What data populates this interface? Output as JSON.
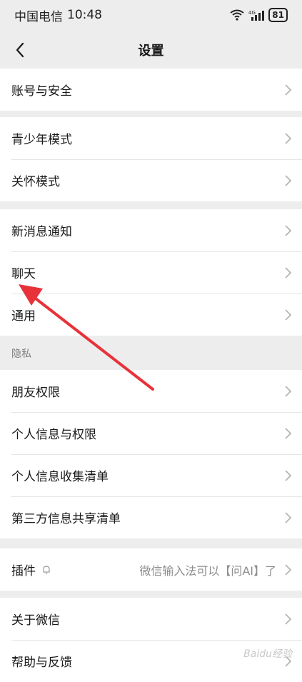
{
  "status_bar": {
    "carrier": "中国电信",
    "time": "10:48",
    "battery": "81"
  },
  "nav": {
    "title": "设置"
  },
  "groups": {
    "account": {
      "items": [
        {
          "label": "账号与安全"
        }
      ]
    },
    "modes": {
      "items": [
        {
          "label": "青少年模式"
        },
        {
          "label": "关怀模式"
        }
      ]
    },
    "general": {
      "items": [
        {
          "label": "新消息通知"
        },
        {
          "label": "聊天"
        },
        {
          "label": "通用"
        }
      ]
    },
    "privacy": {
      "header": "隐私",
      "items": [
        {
          "label": "朋友权限"
        },
        {
          "label": "个人信息与权限"
        },
        {
          "label": "个人信息收集清单"
        },
        {
          "label": "第三方信息共享清单"
        }
      ]
    },
    "plugins": {
      "items": [
        {
          "label": "插件",
          "value": "微信输入法可以【问AI】了"
        }
      ]
    },
    "about": {
      "items": [
        {
          "label": "关于微信"
        },
        {
          "label": "帮助与反馈"
        }
      ]
    }
  },
  "annotation": {
    "color": "#e8323a"
  },
  "watermark": "Baidu经验"
}
